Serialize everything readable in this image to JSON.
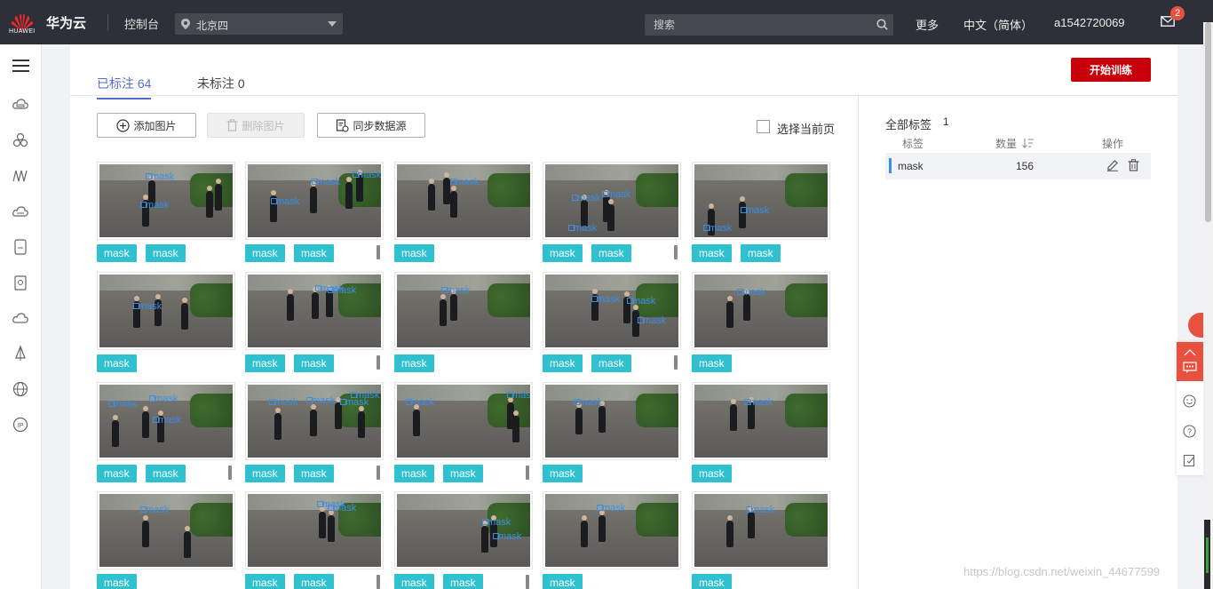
{
  "topbar": {
    "logo_text": "HUAWEI",
    "brand": "华为云",
    "console": "控制台",
    "region": "北京四",
    "search_placeholder": "搜索",
    "more": "更多",
    "language": "中文（简体）",
    "user": "a1542720069",
    "mail_badge": "2"
  },
  "leftnav": {
    "icons": [
      "menu-icon",
      "cloud-server-icon",
      "cloud-cluster-icon",
      "network-icon",
      "storage-icon",
      "database-icon",
      "security-icon",
      "cloud-icon",
      "sail-icon",
      "globe-icon",
      "ip-icon"
    ]
  },
  "tabs": [
    {
      "label": "已标注 64",
      "active": true
    },
    {
      "label": "未标注 0",
      "active": false
    }
  ],
  "toolbar": {
    "start_training": "开始训练",
    "add_images": "添加图片",
    "delete_images": "删除图片",
    "sync_source": "同步数据源",
    "select_page": "选择当前页"
  },
  "images": [
    {
      "tags": [
        "mask",
        "mask"
      ],
      "more": false,
      "labels": [
        "mask",
        "mask"
      ]
    },
    {
      "tags": [
        "mask",
        "mask"
      ],
      "more": true,
      "labels": [
        "mask",
        "mask",
        "mask"
      ]
    },
    {
      "tags": [
        "mask"
      ],
      "more": false,
      "labels": [
        "mask"
      ]
    },
    {
      "tags": [
        "mask",
        "mask"
      ],
      "more": true,
      "labels": [
        "mask",
        "mask",
        "mask"
      ]
    },
    {
      "tags": [
        "mask",
        "mask"
      ],
      "more": false,
      "labels": [
        "mask",
        "mask"
      ]
    },
    {
      "tags": [
        "mask"
      ],
      "more": false,
      "labels": [
        "mask"
      ]
    },
    {
      "tags": [
        "mask",
        "mask"
      ],
      "more": true,
      "labels": [
        "mask",
        "mask"
      ]
    },
    {
      "tags": [
        "mask"
      ],
      "more": false,
      "labels": [
        "mask"
      ]
    },
    {
      "tags": [
        "mask",
        "mask"
      ],
      "more": true,
      "labels": [
        "mask",
        "mask",
        "mask"
      ]
    },
    {
      "tags": [
        "mask"
      ],
      "more": false,
      "labels": [
        "mask"
      ]
    },
    {
      "tags": [
        "mask",
        "mask"
      ],
      "more": true,
      "labels": [
        "mask",
        "mask",
        "mask"
      ]
    },
    {
      "tags": [
        "mask",
        "mask"
      ],
      "more": true,
      "labels": [
        "mask",
        "mask",
        "mask"
      ]
    },
    {
      "tags": [
        "mask",
        "mask"
      ],
      "more": true,
      "labels": [
        "mask",
        "mask"
      ]
    },
    {
      "tags": [
        "mask"
      ],
      "more": false,
      "labels": [
        "mask"
      ]
    },
    {
      "tags": [
        "mask"
      ],
      "more": false,
      "labels": [
        "mask"
      ]
    },
    {
      "tags": [
        "mask"
      ],
      "more": false,
      "labels": [
        "mask"
      ]
    },
    {
      "tags": [
        "mask",
        "mask"
      ],
      "more": true,
      "labels": [
        "mask",
        "mask"
      ]
    },
    {
      "tags": [
        "mask",
        "mask"
      ],
      "more": true,
      "labels": [
        "mask",
        "mask"
      ]
    },
    {
      "tags": [
        "mask"
      ],
      "more": false,
      "labels": [
        "mask"
      ]
    },
    {
      "tags": [
        "mask"
      ],
      "more": false,
      "labels": [
        "mask"
      ]
    }
  ],
  "labels_panel": {
    "title": "全部标签",
    "count": "1",
    "col_label": "标签",
    "col_count": "数量",
    "col_action": "操作",
    "rows": [
      {
        "name": "mask",
        "count": "156"
      }
    ]
  },
  "watermark": "https://blog.csdn.net/weixin_44677599",
  "colors": {
    "accent": "#526ecc",
    "primary_button": "#c7000b",
    "tag": "#2fc1d0",
    "box": "#3a8ee6",
    "topbar": "#2d3038"
  }
}
